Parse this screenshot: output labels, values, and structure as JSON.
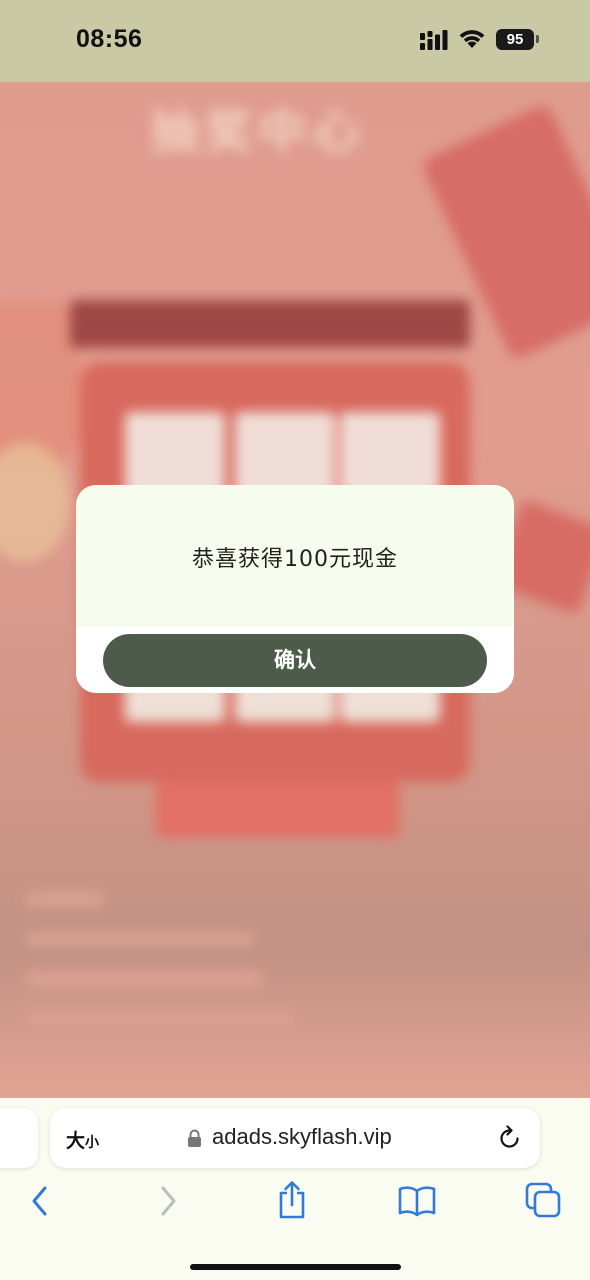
{
  "status_bar": {
    "time": "08:56",
    "battery": "95"
  },
  "background_page": {
    "title": "抽奖中心"
  },
  "modal": {
    "message": "恭喜获得100元现金",
    "confirm_label": "确认"
  },
  "browser": {
    "text_size_big": "大",
    "text_size_small": "小",
    "url": "adads.skyflash.vip",
    "toolbar_icons": [
      "back-icon",
      "forward-icon",
      "share-icon",
      "bookmarks-icon",
      "tabs-icon"
    ]
  },
  "colors": {
    "modal_bg": "#f7fdee",
    "confirm_button": "#4d5c4a",
    "accent_blue": "#2f7bd6"
  }
}
